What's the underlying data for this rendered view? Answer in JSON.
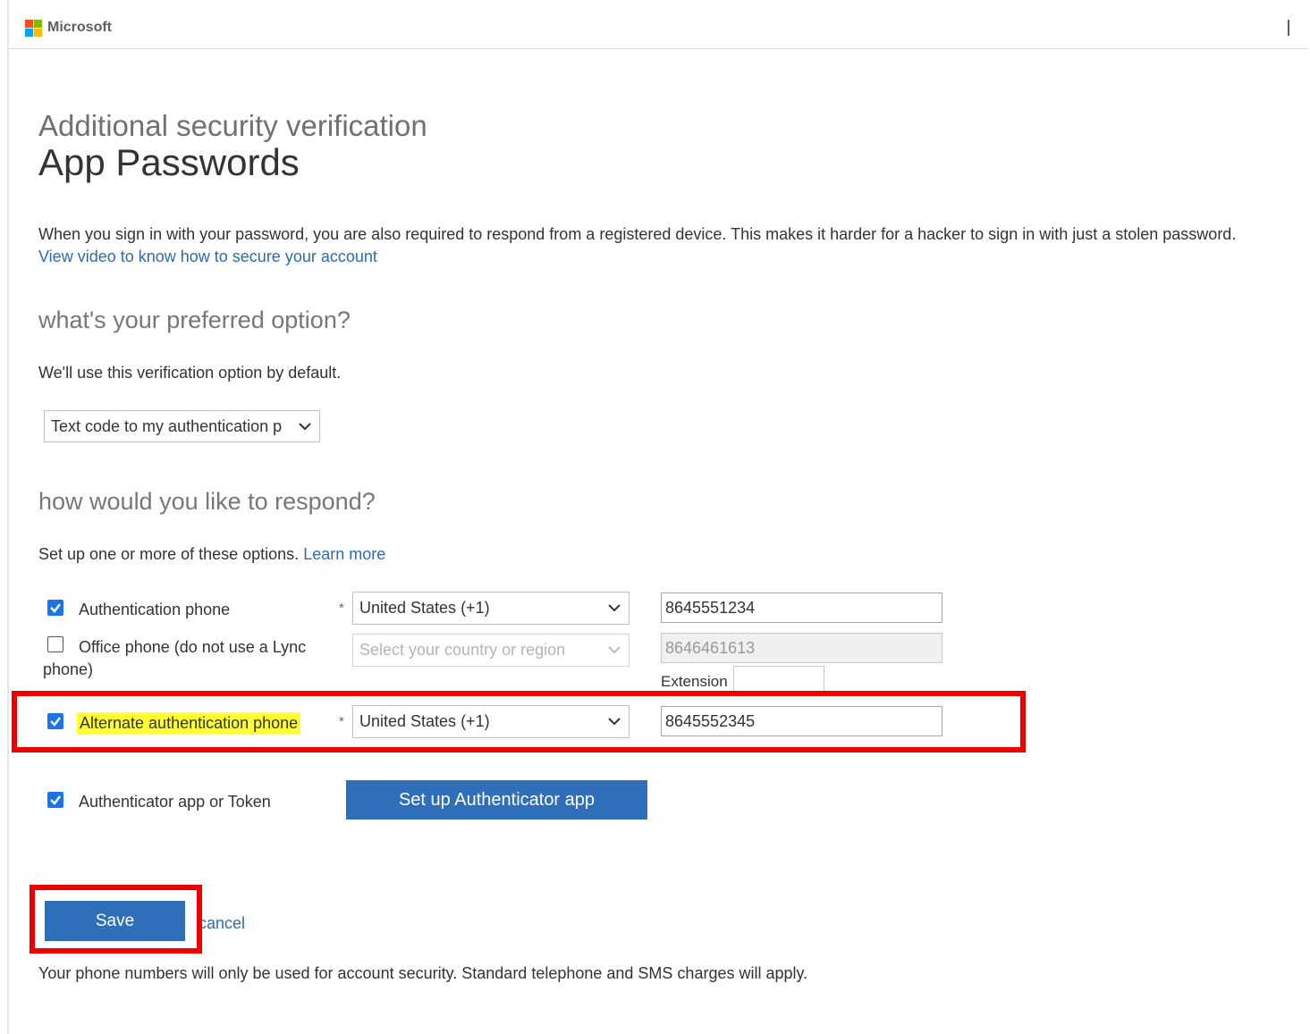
{
  "header": {
    "brand": "Microsoft"
  },
  "page": {
    "title_line1": "Additional security verification",
    "title_line2": "App Passwords",
    "description": "When you sign in with your password, you are also required to respond from a registered device. This makes it harder for a hacker to sign in with just a stolen password.",
    "video_link": "View video to know how to secure your account"
  },
  "preferred": {
    "heading": "what's your preferred option?",
    "subtext": "We'll use this verification option by default.",
    "selected": "Text code to my authentication p"
  },
  "respond": {
    "heading": "how would you like to respond?",
    "subtext": "Set up one or more of these options.",
    "learn_more": "Learn more",
    "required_mark": "*",
    "options": [
      {
        "label": "Authentication phone",
        "checked": true,
        "country": "United States (+1)",
        "phone": "8645551234"
      },
      {
        "label_line1": "Office phone (do not use a Lync",
        "label_line2": "phone)",
        "checked": false,
        "country_placeholder": "Select your country or region",
        "phone": "8646461613",
        "extension_label": "Extension",
        "extension_value": ""
      },
      {
        "label": "Alternate authentication phone",
        "checked": true,
        "country": "United States (+1)",
        "phone": "8645552345"
      },
      {
        "label": "Authenticator app or Token",
        "checked": true,
        "button": "Set up Authenticator app"
      }
    ]
  },
  "actions": {
    "save": "Save",
    "cancel": "cancel"
  },
  "footer": {
    "note": "Your phone numbers will only be used for account security. Standard telephone and SMS charges will apply."
  },
  "colors": {
    "accent": "#2f6fba",
    "link": "#2b6cb0",
    "highlight": "#ffff33",
    "annotation_red": "#ee0000"
  }
}
